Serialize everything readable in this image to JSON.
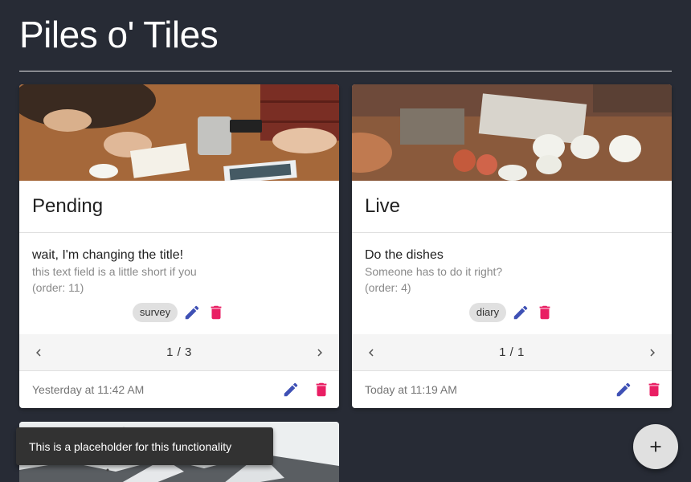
{
  "app": {
    "title": "Piles o' Tiles"
  },
  "cards": [
    {
      "title": "Pending",
      "item_title": "wait, I'm changing the title!",
      "item_text": "this text field is a little short if you",
      "item_order": "(order: 11)",
      "tag": "survey",
      "pager": "1 / 3",
      "timestamp": "Yesterday at 11:42 AM"
    },
    {
      "title": "Live",
      "item_title": "Do the dishes",
      "item_text": "Someone has to do it right?",
      "item_order": "(order: 4)",
      "tag": "diary",
      "pager": "1 / 1",
      "timestamp": "Today at 11:19 AM"
    }
  ],
  "snackbar": {
    "message": "This is a placeholder for this functionality"
  },
  "fab": {
    "icon": "plus-icon"
  },
  "colors": {
    "background": "#272b35",
    "edit": "#3f51b5",
    "delete": "#e91e63",
    "card": "#ffffff"
  }
}
